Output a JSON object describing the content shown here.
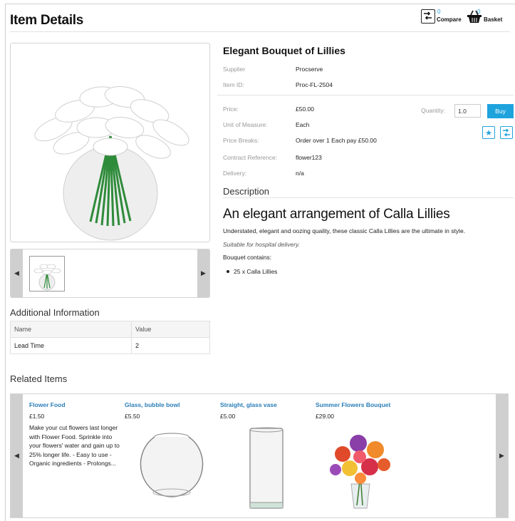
{
  "page": {
    "title": "Item Details"
  },
  "header": {
    "compare": {
      "label": "Compare",
      "count": "0"
    },
    "basket": {
      "label": "Basket",
      "count": "0"
    }
  },
  "product": {
    "name": "Elegant Bouquet of Lillies",
    "supplier_label": "Supplier",
    "supplier": "Procserve",
    "item_id_label": "Item ID:",
    "item_id": "Proc-FL-2504",
    "price_label": "Price:",
    "price": "£50.00",
    "uom_label": "Unit of Measure:",
    "uom": "Each",
    "price_breaks_label": "Price Breaks:",
    "price_breaks": "Order over 1 Each pay £50.00",
    "contract_label": "Contract Reference:",
    "contract": "flower123",
    "delivery_label": "Delivery:",
    "delivery": "n/a",
    "quantity_label": "Quantity:",
    "quantity": "1.0",
    "buy_label": "Buy"
  },
  "description": {
    "heading": "Description",
    "title": "An elegant arrangement of Calla Lillies",
    "text": "Understated, elegant and oozing quality, these classic Calla Lillies are the ultimate in style.",
    "note": "Suitable for hospital delivery.",
    "contains_label": "Bouquet contains:",
    "items": [
      "25 x Calla Lillies"
    ]
  },
  "additional": {
    "heading": "Additional Information",
    "columns": [
      "Name",
      "Value"
    ],
    "rows": [
      [
        "Lead Time",
        "2"
      ]
    ]
  },
  "related": {
    "heading": "Related Items",
    "items": [
      {
        "name": "Flower Food",
        "price": "£1.50",
        "desc": "Make your cut flowers last longer with Flower Food. Sprinkle into your flowers' water and gain up to 25% longer life. - Easy to use - Organic ingredients - Prolongs..."
      },
      {
        "name": "Glass, bubble bowl",
        "price": "£5.50"
      },
      {
        "name": "Straight, glass vase",
        "price": "£5.00"
      },
      {
        "name": "Summer Flowers Bouquet",
        "price": "£29.00"
      }
    ]
  },
  "colors": {
    "accent": "#1fa3dd",
    "link": "#2a7eb8"
  }
}
